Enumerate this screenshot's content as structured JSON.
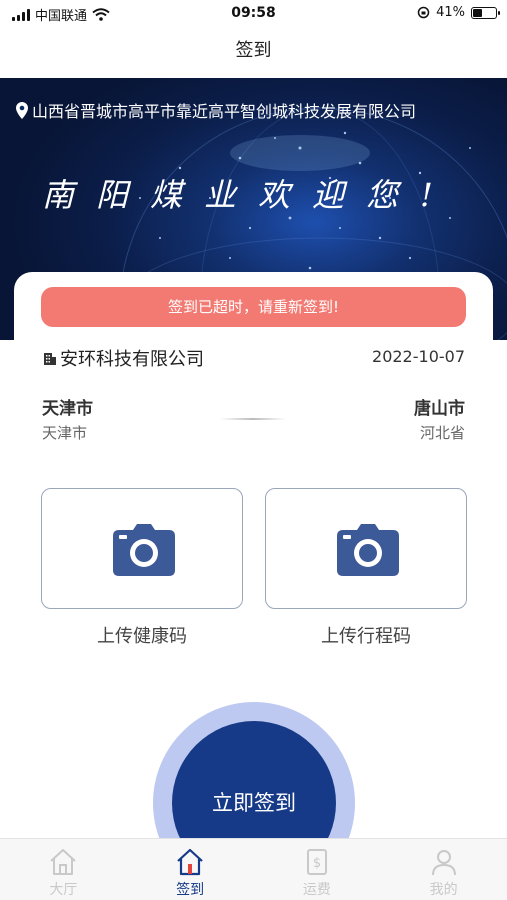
{
  "status_bar": {
    "carrier": "中国联通",
    "time": "09:58",
    "battery_percent": "41%",
    "battery_level": 0.41
  },
  "nav": {
    "title": "签到"
  },
  "banner": {
    "location": "山西省晋城市高平市靠近高平智创城科技发展有限公司",
    "welcome": "南阳煤业欢迎您!"
  },
  "card": {
    "alert": "签到已超时，请重新签到!",
    "company": "安环科技有限公司",
    "date": "2022-10-07",
    "route": {
      "from_city": "天津市",
      "from_province": "天津市",
      "to_city": "唐山市",
      "to_province": "河北省"
    },
    "uploads": {
      "health_label": "上传健康码",
      "trip_label": "上传行程码"
    },
    "signin_label": "立即签到"
  },
  "tabbar": {
    "items": [
      {
        "label": "大厅",
        "icon": "home-icon",
        "active": false
      },
      {
        "label": "签到",
        "icon": "signin-icon",
        "active": true
      },
      {
        "label": "运费",
        "icon": "freight-icon",
        "active": false
      },
      {
        "label": "我的",
        "icon": "profile-icon",
        "active": false
      }
    ]
  },
  "colors": {
    "primary": "#163a87",
    "alert": "#f27a73",
    "camera": "#3d5a98",
    "ring": "#bdc9f1"
  }
}
